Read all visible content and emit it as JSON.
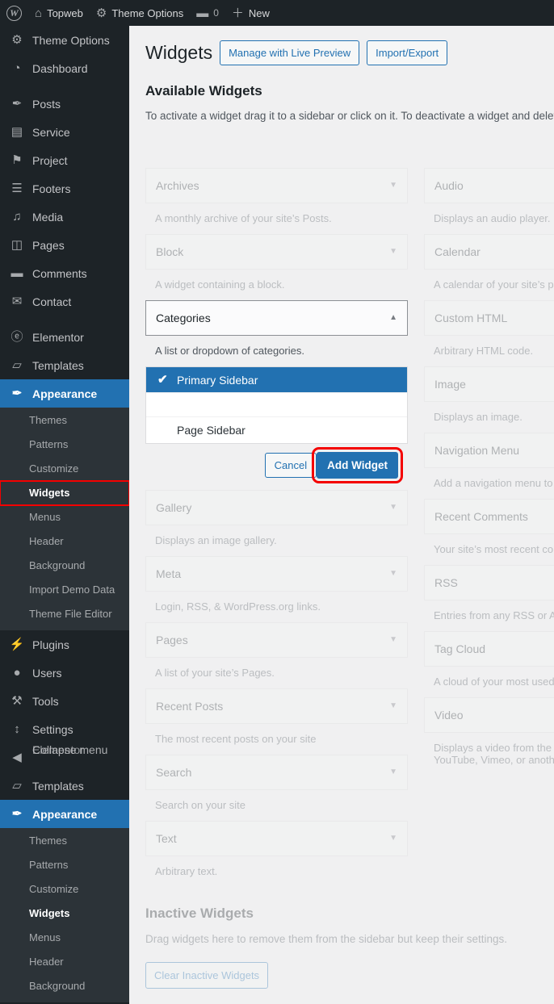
{
  "adminbar": {
    "logo_icon": "wordpress-logo-icon",
    "items": [
      {
        "icon": "home-icon",
        "glyph": "⌂",
        "label": "Topweb"
      },
      {
        "icon": "gear-icon",
        "glyph": "⚙",
        "label": "Theme Options"
      },
      {
        "icon": "comment-icon",
        "glyph": "▬",
        "label": "",
        "count": "0"
      },
      {
        "icon": "plus-icon",
        "glyph": "＋",
        "label": "New"
      }
    ]
  },
  "sidebar": {
    "top_items": [
      {
        "label": "Theme Options",
        "icon": "gear-icon",
        "glyph": "⚙"
      },
      {
        "label": "Dashboard",
        "icon": "dashboard-icon",
        "glyph": "◔"
      },
      {
        "label": "Posts",
        "icon": "pin-icon",
        "glyph": "✒"
      },
      {
        "label": "Service",
        "icon": "layout-icon",
        "glyph": "▤"
      },
      {
        "label": "Project",
        "icon": "flag-icon",
        "glyph": "⚑"
      },
      {
        "label": "Footers",
        "icon": "menu-lines-icon",
        "glyph": "☰"
      },
      {
        "label": "Media",
        "icon": "media-icon",
        "glyph": "♫"
      },
      {
        "label": "Pages",
        "icon": "pages-icon",
        "glyph": "◫"
      },
      {
        "label": "Comments",
        "icon": "comment-icon",
        "glyph": "▬"
      },
      {
        "label": "Contact",
        "icon": "envelope-icon",
        "glyph": "✉"
      },
      {
        "label": "Elementor",
        "icon": "elementor-icon",
        "glyph": "ⓔ"
      },
      {
        "label": "Templates",
        "icon": "folder-icon",
        "glyph": "▱"
      }
    ],
    "appearance": {
      "label": "Appearance",
      "icon": "brush-icon",
      "glyph": "✒"
    },
    "appearance_submenu": [
      "Themes",
      "Patterns",
      "Customize",
      "Widgets",
      "Menus",
      "Header",
      "Background",
      "Import Demo Data",
      "Theme File Editor"
    ],
    "appearance_submenu_current": "Widgets",
    "lower_items": [
      {
        "label": "Plugins",
        "icon": "plug-icon",
        "glyph": "⚡"
      },
      {
        "label": "Users",
        "icon": "user-icon",
        "glyph": "●"
      },
      {
        "label": "Tools",
        "icon": "wrench-icon",
        "glyph": "⚒"
      },
      {
        "label": "Settings",
        "icon": "sliders-icon",
        "glyph": "↕"
      }
    ],
    "glitch_row": {
      "icon": "collapse-icon",
      "glyph": "◀",
      "text_under": "Elementor",
      "text_over": "Collapse menu"
    },
    "templates_item": {
      "label": "Templates",
      "icon": "folder-icon",
      "glyph": "▱"
    },
    "appearance_second": {
      "label": "Appearance",
      "icon": "brush-icon",
      "glyph": "✒"
    },
    "appearance_submenu_2": [
      "Themes",
      "Patterns",
      "Customize",
      "Widgets",
      "Menus",
      "Header",
      "Background"
    ],
    "appearance_submenu_2_current": "Widgets"
  },
  "main": {
    "title": "Widgets",
    "manage_live_preview_label": "Manage with Live Preview",
    "import_export_label": "Import/Export",
    "available_widgets_title": "Available Widgets",
    "available_widgets_desc": "To activate a widget drag it to a sidebar or click on it. To deactivate a widget and delete its settings, drag it back.",
    "widgets_left": [
      {
        "name": "Archives",
        "desc": "A monthly archive of your site’s Posts.",
        "state": "ghost"
      },
      {
        "name": "Block",
        "desc": "A widget containing a block.",
        "state": "ghost"
      },
      {
        "name": "Categories",
        "desc": "A list or dropdown of categories.",
        "state": "open"
      },
      {
        "name": "Gallery",
        "desc": "Displays an image gallery.",
        "state": "ghost"
      },
      {
        "name": "Meta",
        "desc": "Login, RSS, & WordPress.org links.",
        "state": "ghost"
      },
      {
        "name": "Pages",
        "desc": "A list of your site’s Pages.",
        "state": "ghost"
      },
      {
        "name": "Recent Posts",
        "desc": "The most recent posts on your site",
        "state": "ghost"
      },
      {
        "name": "Search",
        "desc": "Search on your site",
        "state": "ghost"
      },
      {
        "name": "Text",
        "desc": "Arbitrary text.",
        "state": "ghost"
      }
    ],
    "widgets_right": [
      {
        "name": "Audio",
        "desc": "Displays an audio player.",
        "state": "ghost"
      },
      {
        "name": "Calendar",
        "desc": "A calendar of your site’s posts.",
        "state": "ghost"
      },
      {
        "name": "Custom HTML",
        "desc": "Arbitrary HTML code.",
        "state": "ghost"
      },
      {
        "name": "Image",
        "desc": "Displays an image.",
        "state": "ghost"
      },
      {
        "name": "Navigation Menu",
        "desc": "Add a navigation menu to your sidebar.",
        "state": "ghost"
      },
      {
        "name": "Recent Comments",
        "desc": "Your site’s most recent comments.",
        "state": "ghost"
      },
      {
        "name": "RSS",
        "desc": "Entries from any RSS or Atom feed.",
        "state": "ghost"
      },
      {
        "name": "Tag Cloud",
        "desc": "A cloud of your most used tags.",
        "state": "ghost"
      },
      {
        "name": "Video",
        "desc": "Displays a video from the media library or from YouTube, Vimeo, or another provider.",
        "state": "ghost"
      }
    ],
    "categories_panel": {
      "options": [
        {
          "label": "Primary Sidebar",
          "selected": true
        },
        {
          "label": "",
          "selected": false,
          "blank": true
        },
        {
          "label": "Page Sidebar",
          "selected": false
        }
      ],
      "cancel_label": "Cancel",
      "add_widget_label": "Add Widget"
    },
    "inactive": {
      "title": "Inactive Widgets",
      "desc": "Drag widgets here to remove them from the sidebar but keep their settings.",
      "clear_label": "Clear Inactive Widgets"
    }
  },
  "colors": {
    "wp_blue": "#2271b1",
    "admin_dark": "#1d2327",
    "submenu_dark": "#2c3338",
    "highlight_red": "#f40000",
    "content_bg": "#f0f0f1"
  },
  "icons": {
    "caret_down": "▼",
    "caret_up": "▲",
    "check": "✔"
  }
}
